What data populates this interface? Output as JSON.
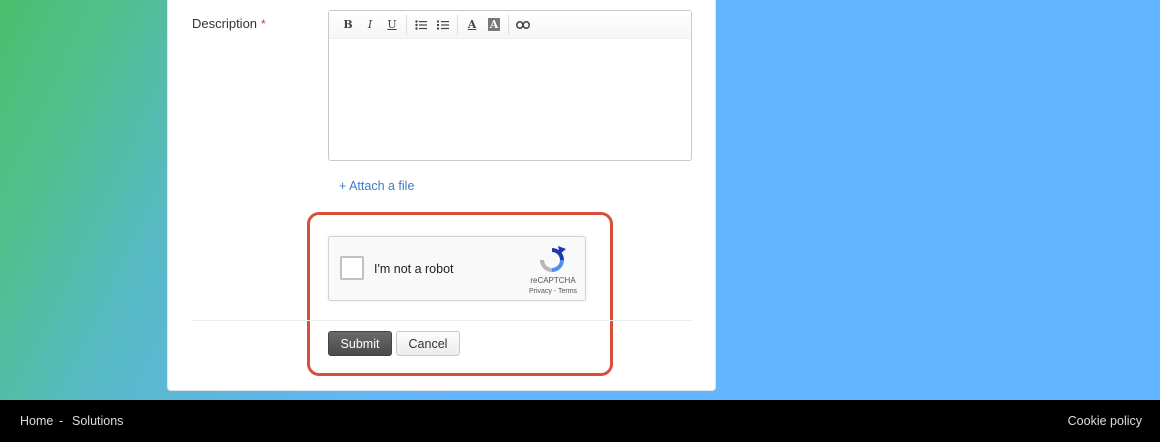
{
  "form": {
    "description_label": "Description",
    "required_mark": "*",
    "attach_link": "+ Attach a file"
  },
  "editor": {
    "toolbar": [
      {
        "name": "bold-button",
        "glyph": "B"
      },
      {
        "name": "italic-button",
        "glyph": "I"
      },
      {
        "name": "underline-button",
        "glyph": "U"
      },
      {
        "name": "bullet-list-button",
        "glyph": "bullets-icon"
      },
      {
        "name": "numbered-list-button",
        "glyph": "numbered-list-icon"
      },
      {
        "name": "font-color-button",
        "glyph": "A"
      },
      {
        "name": "background-color-button",
        "glyph": "A"
      },
      {
        "name": "link-button",
        "glyph": "link-icon"
      }
    ],
    "content": ""
  },
  "recaptcha": {
    "label": "I'm not a robot",
    "brand": "reCAPTCHA",
    "links": "Privacy - Terms",
    "checked": false
  },
  "buttons": {
    "submit": "Submit",
    "cancel": "Cancel"
  },
  "footer": {
    "home": "Home",
    "separator": "-",
    "solutions": "Solutions",
    "cookie": "Cookie policy"
  },
  "colors": {
    "highlight": "#d9503a",
    "link": "#3d7cc9",
    "required": "#d33"
  }
}
